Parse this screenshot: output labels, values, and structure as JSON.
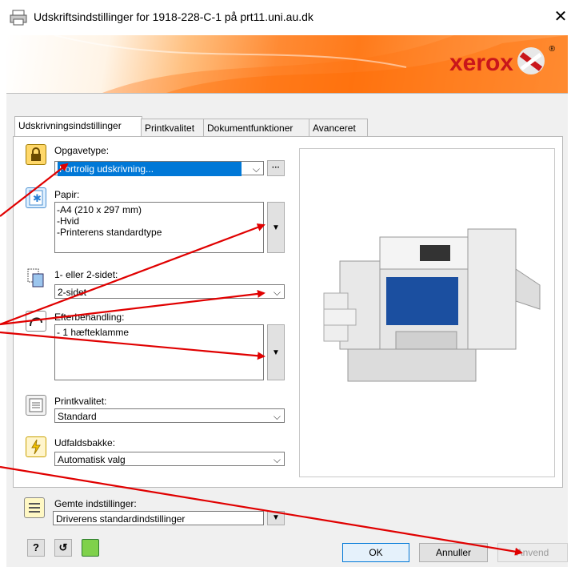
{
  "window": {
    "title": "Udskriftsindstillinger for 1918-228-C-1 på prt11.uni.au.dk",
    "close_glyph": "✕"
  },
  "banner": {
    "brand": "xerox",
    "brand_mark": "®"
  },
  "tabs": [
    {
      "label": "Udskrivningsindstillinger"
    },
    {
      "label": "Printkvalitet"
    },
    {
      "label": "Dokumentfunktioner"
    },
    {
      "label": "Avanceret"
    }
  ],
  "job_type": {
    "label": "Opgavetype:",
    "value": "Fortrolig udskrivning...",
    "more_label": "···"
  },
  "paper": {
    "label": "Papir:",
    "lines": [
      "-A4 (210 x 297 mm)",
      "-Hvid",
      "-Printerens standardtype"
    ]
  },
  "duplex": {
    "label": "1- eller 2-sidet:",
    "value": "2-sidet"
  },
  "finishing": {
    "label": "Efterbehandling:",
    "lines": [
      "- 1 hæfteklamme"
    ]
  },
  "print_quality": {
    "label": "Printkvalitet:",
    "value": "Standard"
  },
  "output_tray": {
    "label": "Udfaldsbakke:",
    "value": "Automatisk valg"
  },
  "saved_settings": {
    "label": "Gemte indstillinger:",
    "value": "Driverens standardindstillinger"
  },
  "buttons": {
    "help": "?",
    "reset": "↺",
    "ok": "OK",
    "cancel": "Annuller",
    "apply": "Anvend"
  },
  "colors": {
    "annotation_arrow": "#e00000",
    "selection": "#0078d7",
    "xerox_red": "#c9161b"
  }
}
